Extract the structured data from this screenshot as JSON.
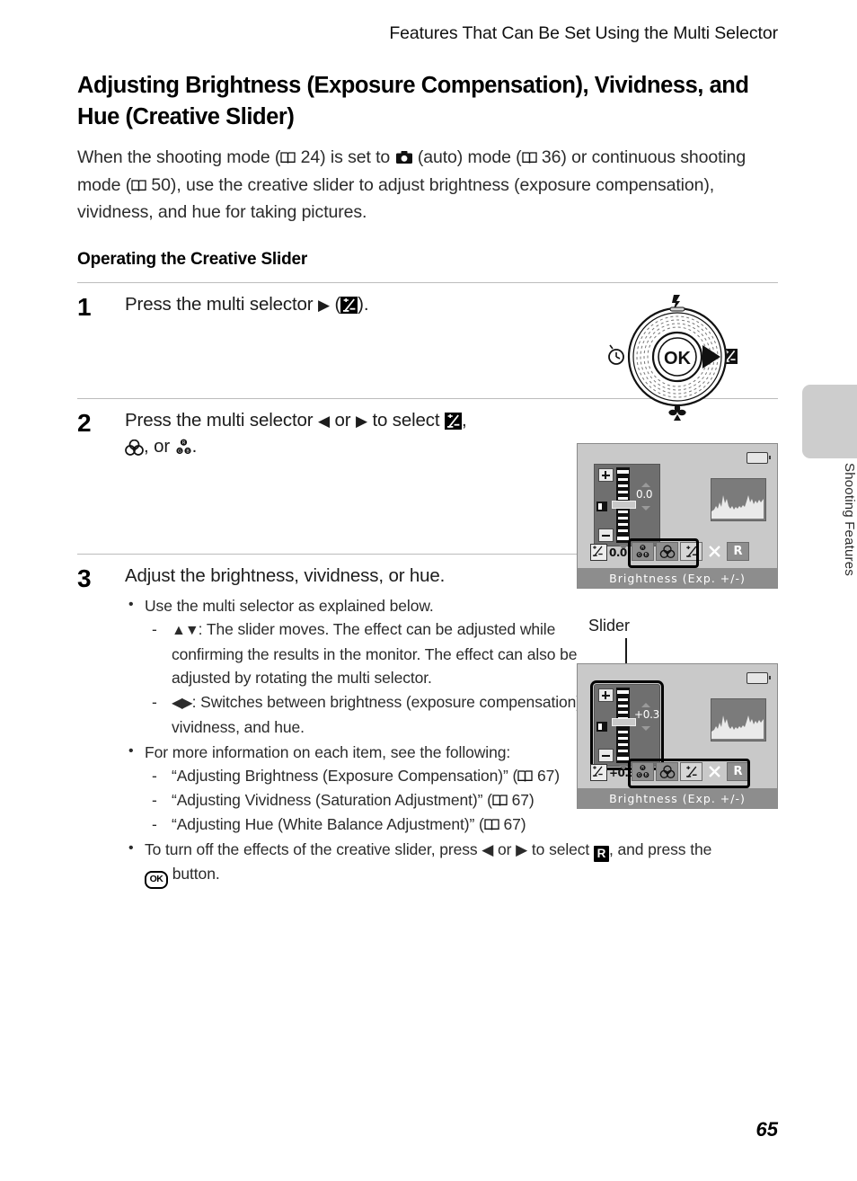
{
  "header": {
    "running_head": "Features That Can Be Set Using the Multi Selector"
  },
  "title": "Adjusting Brightness (Exposure Compensation), Vividness, and Hue (Creative Slider)",
  "intro": {
    "p1": "When the shooting mode (",
    "ref1": "24",
    "p2": ") is set to",
    "p3": "(auto) mode (",
    "ref2": "36",
    "p4": ") or continuous shooting mode (",
    "ref3": "50",
    "p5": "), use the creative slider to adjust brightness (exposure compensation), vividness, and hue for taking pictures."
  },
  "subheading": "Operating the Creative Slider",
  "steps": [
    {
      "number": "1",
      "head_a": "Press the multi selector",
      "head_b": "(",
      "head_c": ")."
    },
    {
      "number": "2",
      "head_a": "Press the multi selector",
      "head_or": "or",
      "head_b": "to select",
      "head_c": ",",
      "head_d": ", or",
      "head_e": "."
    },
    {
      "number": "3",
      "head_a": "Adjust the brightness, vividness, or hue.",
      "bullet1": "Use the multi selector as explained below.",
      "dash1": ": The slider moves. The effect can be adjusted while confirming the results in the monitor. The effect can also be adjusted by rotating the multi selector.",
      "dash2": ": Switches between brightness (exposure compensation), vividness, and hue.",
      "bullet2": "For more information on each item, see the following:",
      "ref_items": [
        {
          "text": "“Adjusting Brightness (Exposure Compensation)” (",
          "page": "67"
        },
        {
          "text": "“Adjusting Vividness (Saturation Adjustment)” (",
          "page": "67"
        },
        {
          "text": "“Adjusting Hue (White Balance Adjustment)” (",
          "page": "67"
        }
      ],
      "bullet3_a": "To turn off the effects of the creative slider, press",
      "bullet3_or": "or",
      "bullet3_b": "to select",
      "bullet3_c": ", and press the",
      "bullet3_d": "button."
    }
  ],
  "dial": {
    "ok_label": "OK",
    "top_icon": "flash-icon",
    "left_icon": "self-timer-icon",
    "bottom_icon": "macro-flower-icon",
    "right_icon": "exposure-compensation-icon"
  },
  "monitors": [
    {
      "name": "monitor-step2",
      "slider_value": "0.0",
      "caption": "Brightness (Exp. +/-)",
      "exposure_tag": "0.0",
      "selected_icon": "brightness",
      "strip_icons": [
        "hue-gb-icon",
        "vividness-icon",
        "brightness-icon",
        "close-x-icon",
        "reset-r-icon"
      ],
      "strip_labels": [
        "",
        "",
        "",
        "X",
        "R"
      ],
      "highlight": "strip"
    },
    {
      "name": "monitor-step3",
      "slider_value": "+0.3",
      "caption": "Brightness (Exp. +/-)",
      "exposure_tag": "+0.3",
      "selected_icon": "brightness",
      "strip_icons": [
        "hue-gb-icon",
        "vividness-icon",
        "brightness-icon",
        "close-x-icon",
        "reset-r-icon"
      ],
      "strip_labels": [
        "",
        "",
        "",
        "X",
        "R"
      ],
      "highlight": "slider-and-strip"
    }
  ],
  "callout": {
    "label": "Slider"
  },
  "side_tab": {
    "label": "Shooting Features"
  },
  "footer": {
    "page_number": "65"
  },
  "colors": {
    "tab_gray": "#cdcdcd",
    "monitor_bg": "#c9c9c9",
    "caption_bar": "#8d8d8d",
    "slider_panel": "#6f6f6f",
    "rule": "#bcbcbc"
  }
}
